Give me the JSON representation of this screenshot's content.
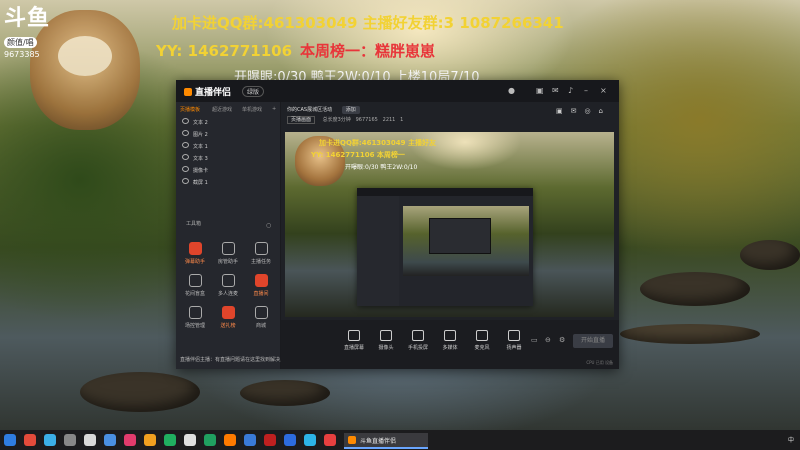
{
  "stream_overlay": {
    "logo_text": "斗鱼",
    "logo_tag": "颜值/唱",
    "room_id": "9673385",
    "line1": "加卡进QQ群:461303049  主播好友群:3  1087266341",
    "line2_prefix": "YY: 1462771106",
    "line2_red": "本周榜一：糕胖崽崽",
    "line3": "开曝眼:0/30  鸭王2W:0/10  上楼10局7/10"
  },
  "app": {
    "name": "直播伴侣",
    "version_badge": "绿版",
    "left_tabs": [
      "页播模板",
      "超近游戏",
      "单机游戏"
    ],
    "sources": [
      "文本 2",
      "图片 2",
      "文本 1",
      "文本 3",
      "摄像卡",
      "截屏 1"
    ],
    "toolbox_title": "工具箱",
    "tools": [
      {
        "label": "弹幕助手",
        "hot": true
      },
      {
        "label": "房管助手",
        "hot": false
      },
      {
        "label": "主播任务",
        "hot": false
      },
      {
        "label": "花间盲盒",
        "hot": false
      },
      {
        "label": "多人连麦",
        "hot": false
      },
      {
        "label": "直播间",
        "hot": true
      },
      {
        "label": "场控管理",
        "hot": false
      },
      {
        "label": "送礼榜",
        "hot": true
      },
      {
        "label": "商城",
        "hot": false
      }
    ],
    "notice": "直播伴侣主播：有直播问题请在这里找到解决，请正规使用工具直播",
    "scene_tabs": [
      "你的CAS展城区活动",
      "添加"
    ],
    "info_row": [
      "页播画面",
      "总长度3分钟",
      "9677165",
      "2211",
      "1"
    ],
    "bottom_tools": [
      "直播屏幕",
      "摄像头",
      "手机投屏",
      "多媒体",
      "麦克风",
      "扬声器"
    ],
    "start_button": "开始直播",
    "status": "CPU 已用 设备"
  },
  "preview_overlay": {
    "line1": "加卡进QQ群:461303049  主播好友",
    "line2": "YY: 1462771106  本周榜一",
    "line3": "开曝眼:0/30  鸭王2W:0/10"
  },
  "taskbar": {
    "active_app": "斗鱼直播伴侣",
    "tray_text": "中"
  }
}
